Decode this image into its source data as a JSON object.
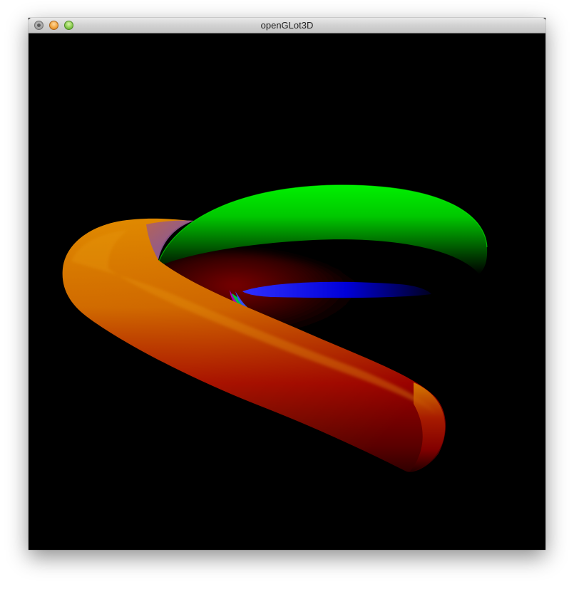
{
  "window": {
    "title": "openGLot3D"
  },
  "titlebar": {
    "buttons": [
      "close-button",
      "minimize-button",
      "zoom-button"
    ]
  },
  "canvas": {
    "background": "#000000",
    "colors": {
      "orange": "#e08000",
      "red": "#a00000",
      "green": "#00e000",
      "blue": "#0000e0"
    }
  }
}
